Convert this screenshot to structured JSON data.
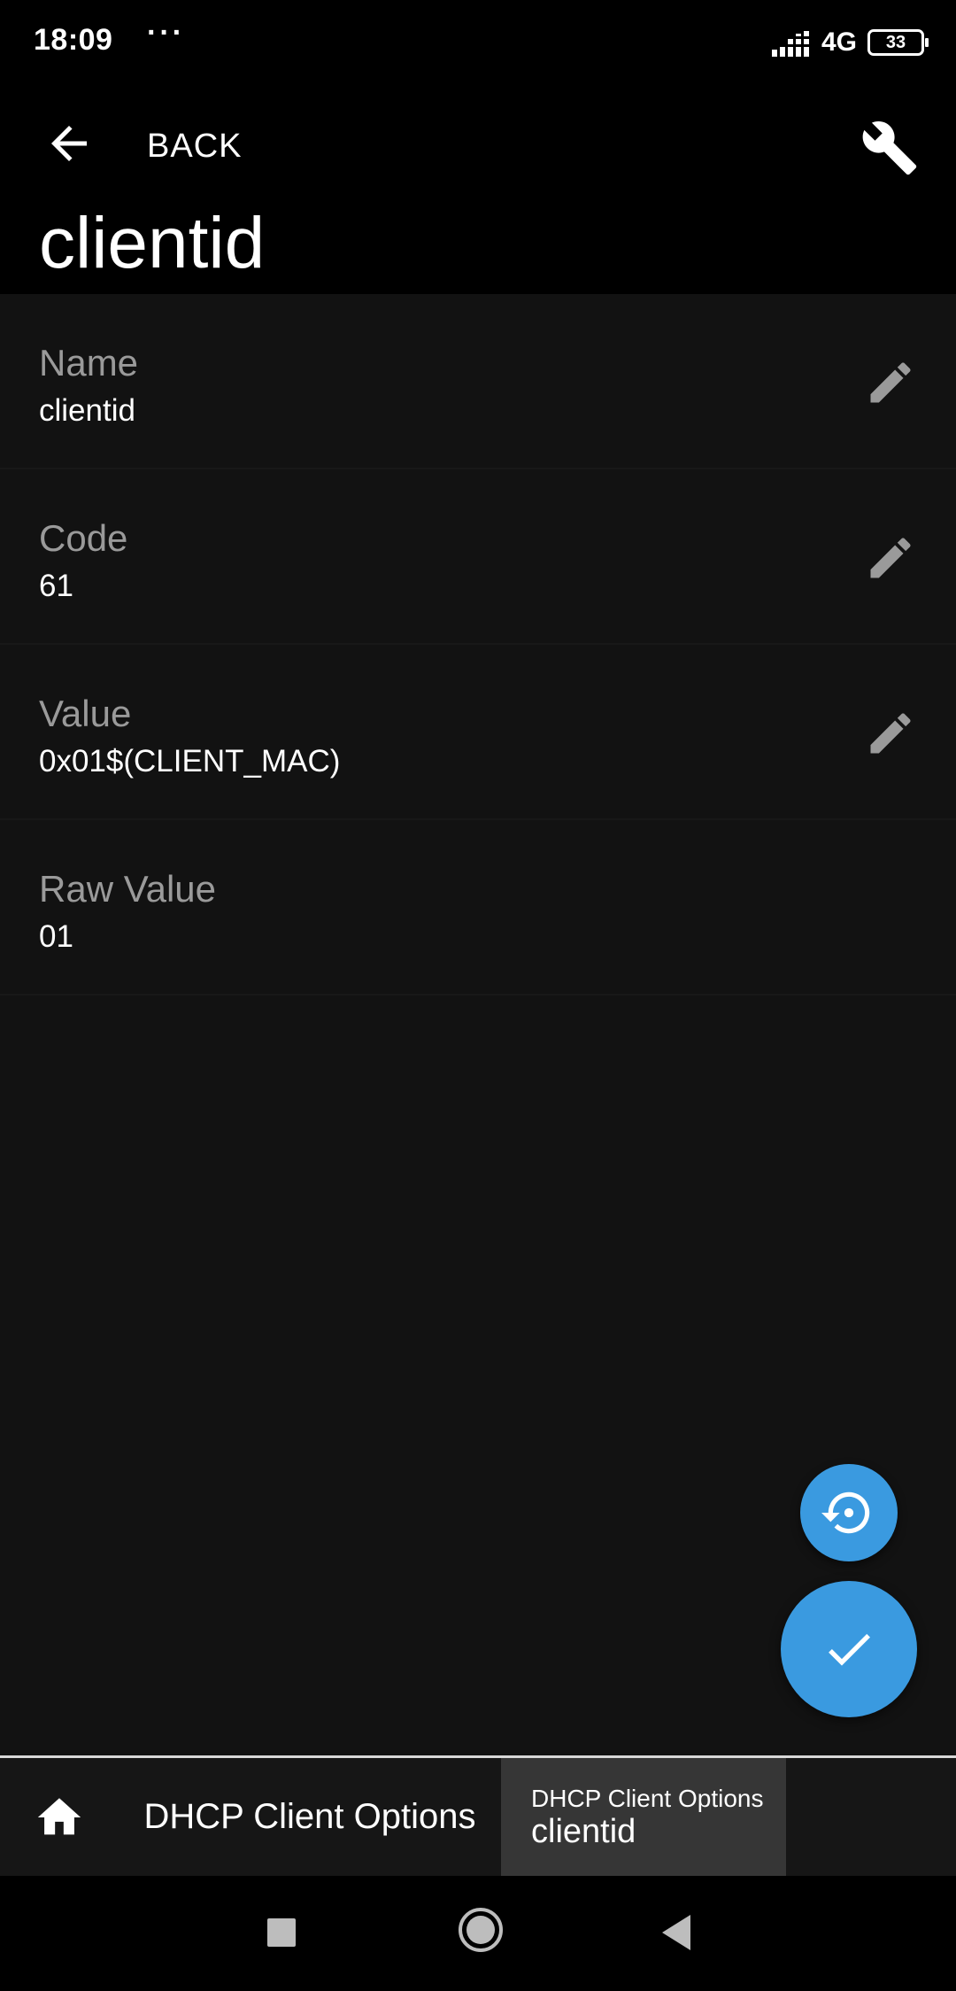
{
  "status_bar": {
    "time": "18:09",
    "dots": "···",
    "network": "4G",
    "battery": "33"
  },
  "app_bar": {
    "back_label": "BACK",
    "title": "clientid"
  },
  "fields": [
    {
      "label": "Name",
      "value": "clientid",
      "editable": true
    },
    {
      "label": "Code",
      "value": "61",
      "editable": true
    },
    {
      "label": "Value",
      "value": "0x01$(CLIENT_MAC)",
      "editable": true
    },
    {
      "label": "Raw Value",
      "value": "01",
      "editable": false
    }
  ],
  "breadcrumbs": {
    "parent": "DHCP Client Options",
    "current_parent": "DHCP Client Options",
    "current": "clientid"
  },
  "colors": {
    "accent": "#3a9ae0",
    "background": "#121212",
    "label": "#9a9a9a"
  },
  "icons": {
    "back": "arrow-left-icon",
    "tools": "wrench-icon",
    "edit": "pencil-icon",
    "revert": "restore-icon",
    "confirm": "check-icon",
    "home": "home-icon"
  }
}
